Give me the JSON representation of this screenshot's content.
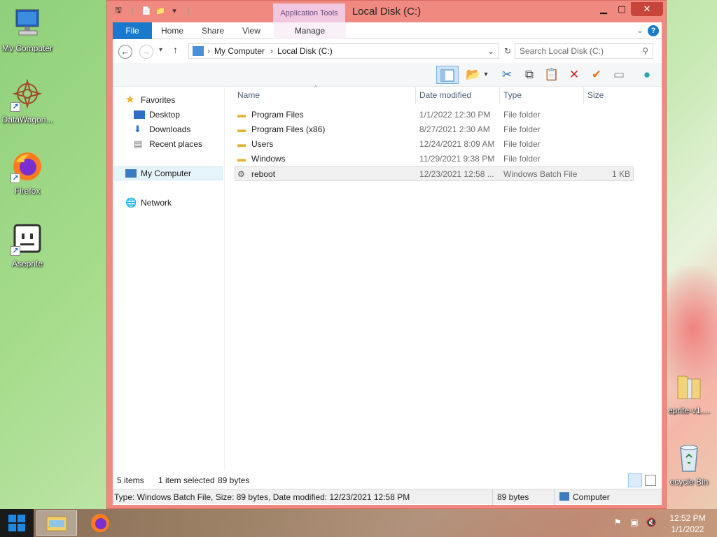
{
  "desktop": {
    "icons": [
      {
        "label": "My Computer"
      },
      {
        "label": "DataWagon..."
      },
      {
        "label": "Firefox"
      },
      {
        "label": "Aseprite"
      },
      {
        "label": "eprite-v1...."
      },
      {
        "label": "ecycle Bin"
      }
    ]
  },
  "window": {
    "title": "Local Disk (C:)",
    "context_tab": "Application Tools",
    "tabs": {
      "file": "File",
      "home": "Home",
      "share": "Share",
      "view": "View",
      "manage": "Manage"
    },
    "address": {
      "crumbs": [
        "My Computer",
        "Local Disk (C:)"
      ]
    },
    "search": {
      "placeholder": "Search Local Disk (C:)"
    },
    "nav": {
      "favorites": "Favorites",
      "desktop": "Desktop",
      "downloads": "Downloads",
      "recent": "Recent places",
      "computer": "My Computer",
      "network": "Network"
    },
    "columns": {
      "name": "Name",
      "date": "Date modified",
      "type": "Type",
      "size": "Size"
    },
    "files": [
      {
        "name": "Program Files",
        "date": "1/1/2022 12:30 PM",
        "type": "File folder",
        "size": ""
      },
      {
        "name": "Program Files (x86)",
        "date": "8/27/2021 2:30 AM",
        "type": "File folder",
        "size": ""
      },
      {
        "name": "Users",
        "date": "12/24/2021 8:09 AM",
        "type": "File folder",
        "size": ""
      },
      {
        "name": "Windows",
        "date": "11/29/2021 9:38 PM",
        "type": "File folder",
        "size": ""
      },
      {
        "name": "reboot",
        "date": "12/23/2021 12:58 ...",
        "type": "Windows Batch File",
        "size": "1 KB"
      }
    ],
    "status": {
      "items": "5 items",
      "selected": "1 item selected",
      "bytes": "89 bytes"
    },
    "details": {
      "text": "Type: Windows Batch File, Size: 89 bytes, Date modified: 12/23/2021 12:58 PM",
      "size": "89 bytes",
      "location": "Computer"
    }
  },
  "taskbar": {
    "time": "12:52 PM",
    "date": "1/1/2022"
  }
}
